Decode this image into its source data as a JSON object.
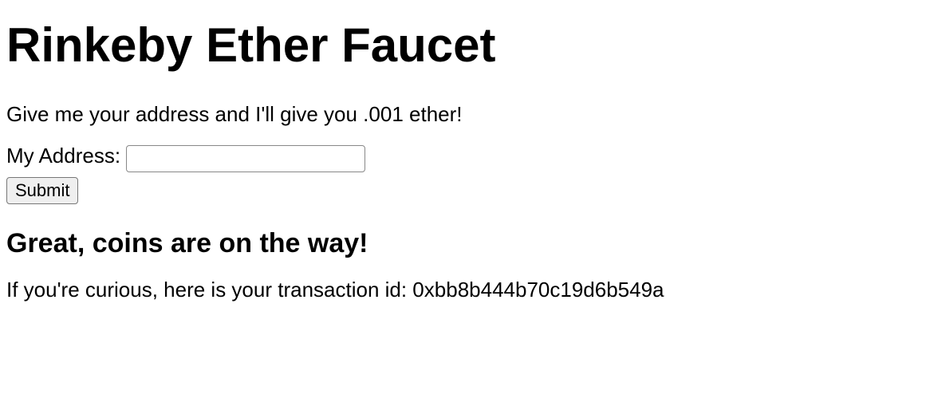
{
  "heading": "Rinkeby Ether Faucet",
  "intro": "Give me your address and I'll give you .001 ether!",
  "form": {
    "address_label": "My Address: ",
    "address_value": "",
    "submit_label": "Submit"
  },
  "result": {
    "heading": "Great, coins are on the way!",
    "transaction_text": "If you're curious, here is your transaction id: 0xbb8b444b70c19d6b549a"
  }
}
